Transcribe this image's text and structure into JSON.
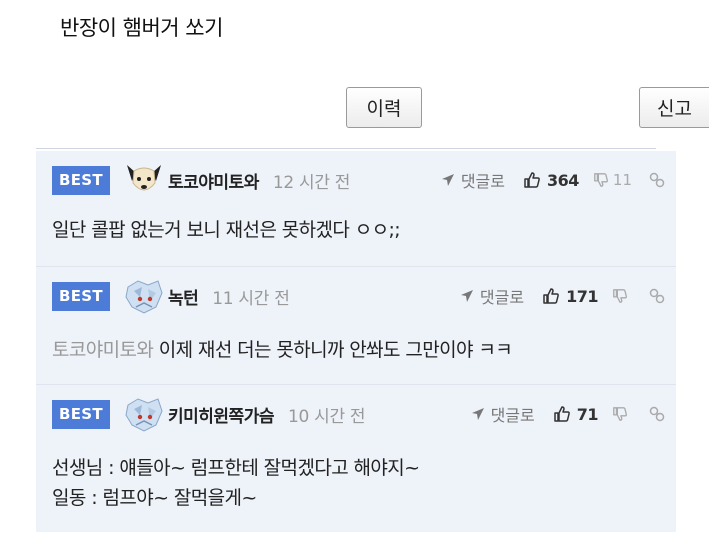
{
  "post": {
    "title": "반장이 햄버거 쏘기"
  },
  "buttons": {
    "history": "이력",
    "report": "신고"
  },
  "comments": [
    {
      "badge": "BEST",
      "avatar": "dog-avatar-icon",
      "nick": "토코야미토와",
      "time": "12 시간 전",
      "reply": "댓글로",
      "likes": "364",
      "dislikes": "11",
      "mention": "",
      "lines": [
        "일단 콜팝 없는거 보니 재선은 못하겠다 ㅇㅇ;;"
      ]
    },
    {
      "badge": "BEST",
      "avatar": "ice-avatar-icon",
      "nick": "녹턴",
      "time": "11 시간 전",
      "reply": "댓글로",
      "likes": "171",
      "dislikes": "",
      "mention": "토코야미토와",
      "lines": [
        "이제 재선 더는 못하니까 안쏴도 그만이야 ㅋㅋ"
      ]
    },
    {
      "badge": "BEST",
      "avatar": "ice-avatar-icon",
      "nick": "키미히윈쪽가슴",
      "time": "10 시간 전",
      "reply": "댓글로",
      "likes": "71",
      "dislikes": "",
      "mention": "",
      "lines": [
        "선생님 : 얘들아~ 럼프한테 잘먹겠다고 해야지~",
        "일동 : 럼프야~ 잘먹을게~"
      ]
    }
  ],
  "colors": {
    "best_badge": "#4d7bd8",
    "comment_bg": "#eef2f9"
  }
}
